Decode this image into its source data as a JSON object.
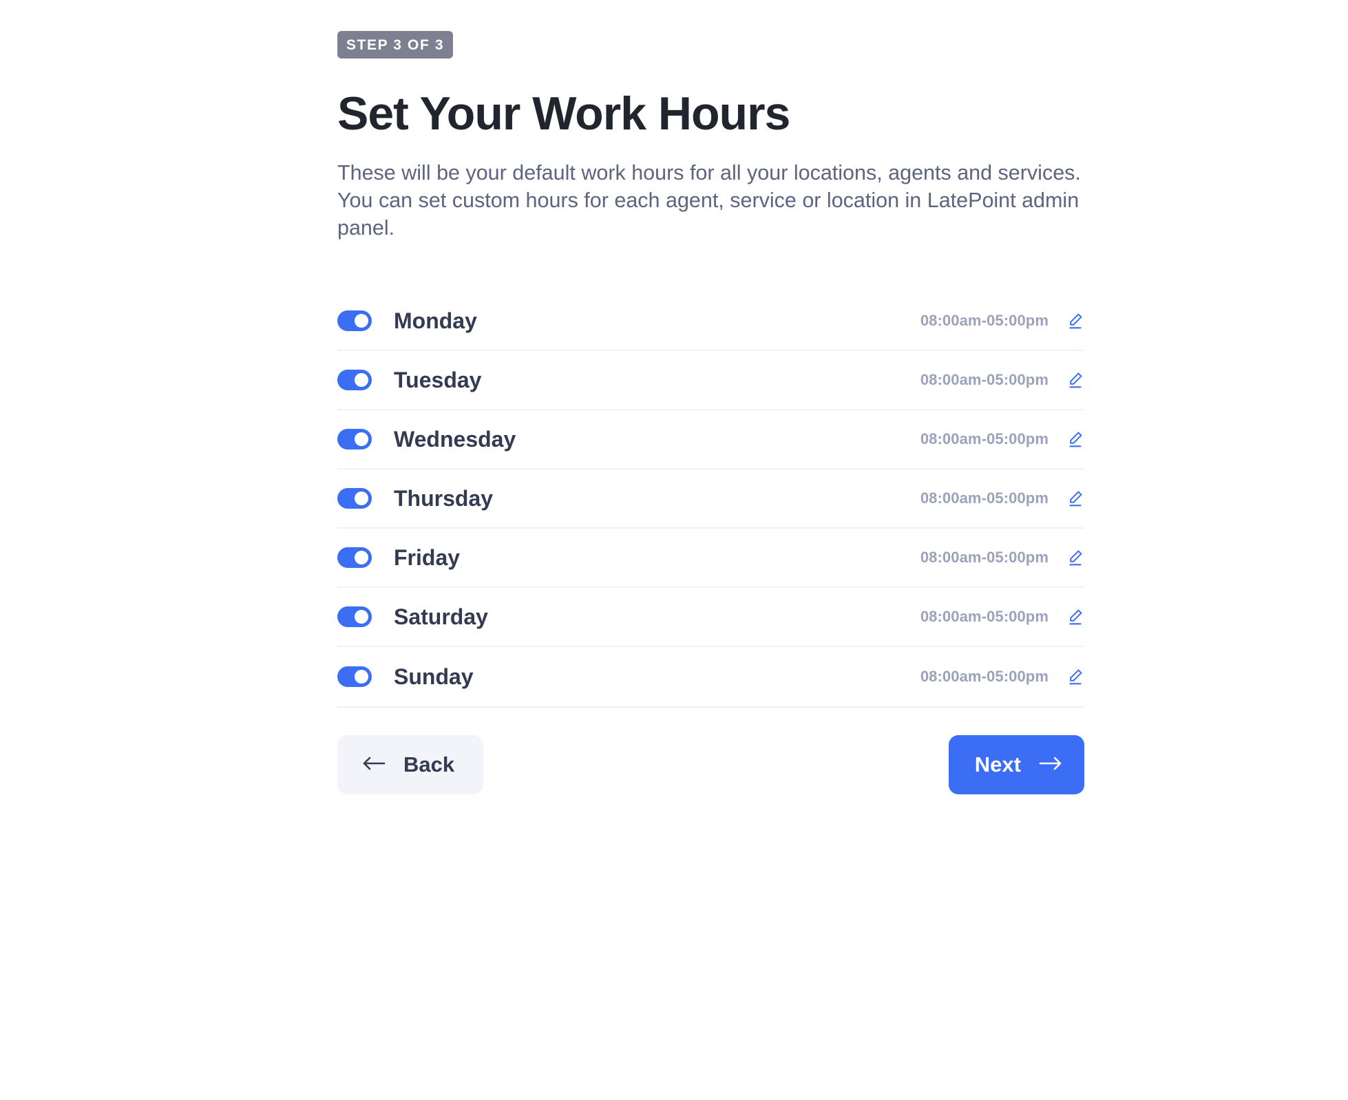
{
  "step_badge": "STEP 3 OF 3",
  "title": "Set Your Work Hours",
  "subtitle": "These will be your default work hours for all your locations, agents and services. You can set custom hours for each agent, service or location in LatePoint admin panel.",
  "colors": {
    "accent": "#3b6ef5",
    "badge_bg": "#7d8091",
    "title": "#21262e",
    "subtitle": "#5d6480",
    "day_label": "#333a52",
    "time_text": "#9ba2bb",
    "divider": "#f0f1f4",
    "back_bg": "#f2f4f9"
  },
  "days": [
    {
      "label": "Monday",
      "hours": "08:00am-05:00pm",
      "enabled": true,
      "edit_icon": "pencil-edit-icon"
    },
    {
      "label": "Tuesday",
      "hours": "08:00am-05:00pm",
      "enabled": true,
      "edit_icon": "pencil-edit-icon"
    },
    {
      "label": "Wednesday",
      "hours": "08:00am-05:00pm",
      "enabled": true,
      "edit_icon": "pencil-edit-icon"
    },
    {
      "label": "Thursday",
      "hours": "08:00am-05:00pm",
      "enabled": true,
      "edit_icon": "pencil-edit-icon"
    },
    {
      "label": "Friday",
      "hours": "08:00am-05:00pm",
      "enabled": true,
      "edit_icon": "pencil-edit-icon"
    },
    {
      "label": "Saturday",
      "hours": "08:00am-05:00pm",
      "enabled": true,
      "edit_icon": "pencil-edit-icon"
    },
    {
      "label": "Sunday",
      "hours": "08:00am-05:00pm",
      "enabled": true,
      "edit_icon": "pencil-edit-icon"
    }
  ],
  "footer": {
    "back_label": "Back",
    "back_icon": "arrow-left-icon",
    "next_label": "Next",
    "next_icon": "arrow-right-icon"
  }
}
